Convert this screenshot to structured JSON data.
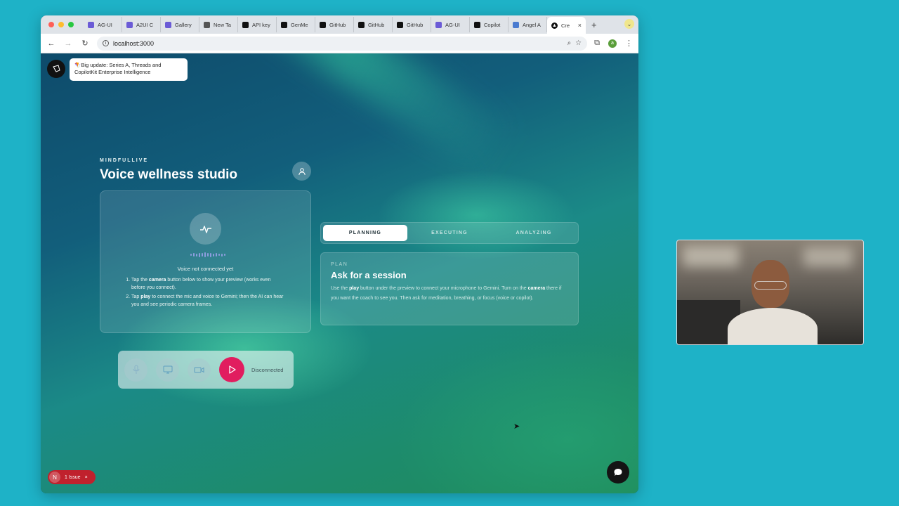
{
  "browser": {
    "tabs": [
      {
        "label": "AG-UI",
        "icon": "ag-ui-icon",
        "color": "#6b5bd6"
      },
      {
        "label": "A2UI C",
        "icon": "ag-ui-icon",
        "color": "#6b5bd6"
      },
      {
        "label": "Gallery",
        "icon": "ag-ui-icon",
        "color": "#6b5bd6"
      },
      {
        "label": "New Ta",
        "icon": "chrome-icon",
        "color": "#555555"
      },
      {
        "label": "API key",
        "icon": "terminal-icon",
        "color": "#111111"
      },
      {
        "label": "GenMe",
        "icon": "m-icon",
        "color": "#111111"
      },
      {
        "label": "GitHub",
        "icon": "github-icon",
        "color": "#111111"
      },
      {
        "label": "GitHub",
        "icon": "github-icon",
        "color": "#111111"
      },
      {
        "label": "GitHub",
        "icon": "github-icon",
        "color": "#111111"
      },
      {
        "label": "AG-UI",
        "icon": "ag-ui-icon",
        "color": "#6b5bd6"
      },
      {
        "label": "Copilot",
        "icon": "github-icon",
        "color": "#111111"
      },
      {
        "label": "Angel A",
        "icon": "image-icon",
        "color": "#4a7bd0"
      }
    ],
    "active_tab": {
      "label": "Cre",
      "close": "×"
    },
    "new_tab": "+",
    "url": "localhost:3000"
  },
  "announcement": {
    "emoji": "🪁",
    "text": "Big update: Series A, Threads and CopilotKit Enterprise Intelligence"
  },
  "app": {
    "kicker": "MINDFULLIVE",
    "title": "Voice wellness studio"
  },
  "voice_panel": {
    "status": "Voice not connected yet",
    "steps": [
      {
        "pre": "Tap the ",
        "bold": "camera",
        "post": " button below to show your preview (works even before you connect)."
      },
      {
        "pre": "Tap ",
        "bold": "play",
        "post": " to connect the mic and voice to Gemini; then the AI can hear you and see periodic camera frames."
      }
    ]
  },
  "controls": {
    "status": "Disconnected",
    "accent": "#e11d5f"
  },
  "phases": [
    {
      "label": "PLANNING",
      "active": true
    },
    {
      "label": "EXECUTING",
      "active": false
    },
    {
      "label": "ANALYZING",
      "active": false
    }
  ],
  "plan": {
    "kicker": "PLAN",
    "title": "Ask for a session",
    "body_1": "Use the ",
    "body_bold_1": "play",
    "body_2": " button under the preview to connect your microphone to Gemini. Turn on the ",
    "body_bold_2": "camera",
    "body_3": " there if you want the coach to see you. Then ask for meditation, breathing, or focus (voice or copilot)."
  },
  "dev_overlay": {
    "badge_letter": "N",
    "issue_label": "1 Issue",
    "close": "×",
    "color": "#c0212d"
  },
  "colors": {
    "desktop": "#1eb2c7"
  }
}
